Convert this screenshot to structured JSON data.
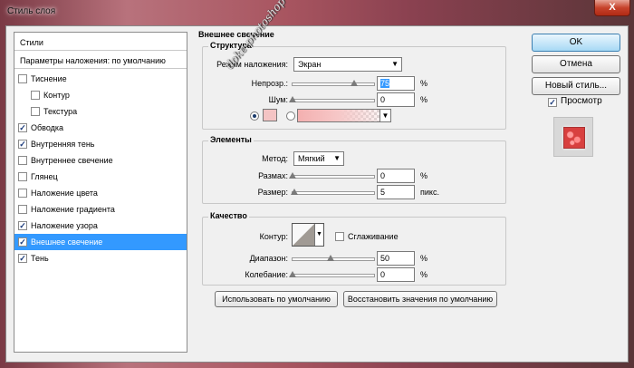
{
  "window": {
    "title": "Стиль слоя",
    "close_label": "X"
  },
  "styles_list": {
    "header": "Стили",
    "blend_defaults": "Параметры наложения: по умолчанию",
    "items": [
      {
        "label": "Тиснение",
        "checked": false,
        "indent": false
      },
      {
        "label": "Контур",
        "checked": false,
        "indent": true
      },
      {
        "label": "Текстура",
        "checked": false,
        "indent": true
      },
      {
        "label": "Обводка",
        "checked": true,
        "indent": false
      },
      {
        "label": "Внутренняя тень",
        "checked": true,
        "indent": false
      },
      {
        "label": "Внутреннее свечение",
        "checked": false,
        "indent": false
      },
      {
        "label": "Глянец",
        "checked": false,
        "indent": false
      },
      {
        "label": "Наложение цвета",
        "checked": false,
        "indent": false
      },
      {
        "label": "Наложение градиента",
        "checked": false,
        "indent": false
      },
      {
        "label": "Наложение узора",
        "checked": true,
        "indent": false
      },
      {
        "label": "Внешнее свечение",
        "checked": true,
        "indent": false,
        "selected": true
      },
      {
        "label": "Тень",
        "checked": true,
        "indent": false
      }
    ]
  },
  "outer_glow": {
    "title": "Внешнее свечение",
    "structure": {
      "title": "Структура",
      "blend_mode_label": "Режим наложения:",
      "blend_mode_value": "Экран",
      "opacity_label": "Непрозр.:",
      "opacity_value": "75",
      "noise_label": "Шум:",
      "noise_value": "0",
      "percent": "%",
      "glow_color": "#f4c4c4"
    },
    "elements": {
      "title": "Элементы",
      "method_label": "Метод:",
      "method_value": "Мягкий",
      "spread_label": "Размах:",
      "spread_value": "0",
      "size_label": "Размер:",
      "size_value": "5",
      "percent": "%",
      "px_unit": "пикс."
    },
    "quality": {
      "title": "Качество",
      "contour_label": "Контур:",
      "antialias_label": "Сглаживание",
      "range_label": "Диапазон:",
      "range_value": "50",
      "jitter_label": "Колебание:",
      "jitter_value": "0",
      "percent": "%"
    },
    "make_default_label": "Использовать по умолчанию",
    "reset_default_label": "Восстановить значения по умолчанию"
  },
  "buttons": {
    "ok": "OK",
    "cancel": "Отмена",
    "new_style": "Новый стиль...",
    "preview_label": "Просмотр",
    "preview_checked": true
  },
  "watermark": "doke-photoshop-creation.blogspot"
}
